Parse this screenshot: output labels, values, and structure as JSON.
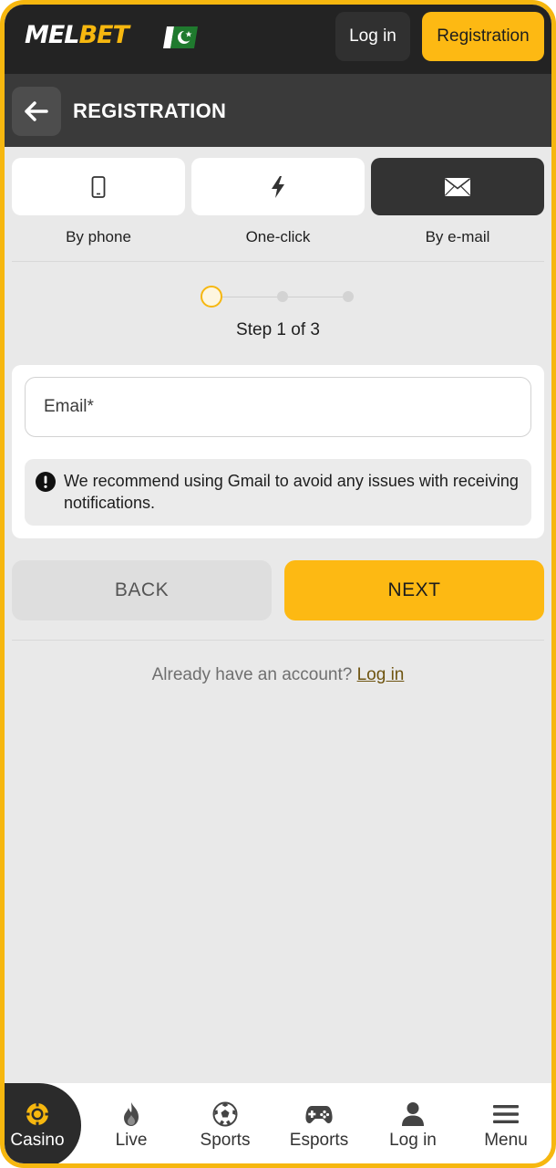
{
  "header": {
    "logo_part1": "MEL",
    "logo_part2": "BET",
    "login_label": "Log in",
    "registration_label": "Registration"
  },
  "titlebar": {
    "title": "REGISTRATION"
  },
  "tabs": [
    {
      "label": "By phone",
      "icon": "phone-icon",
      "active": false
    },
    {
      "label": "One-click",
      "icon": "lightning-icon",
      "active": false
    },
    {
      "label": "By e-mail",
      "icon": "envelope-icon",
      "active": true
    }
  ],
  "stepper": {
    "text": "Step 1 of 3",
    "current": 1,
    "total": 3
  },
  "form": {
    "email_placeholder": "Email*",
    "notice": "We recommend using Gmail to avoid any issues with receiving notifications."
  },
  "actions": {
    "back_label": "BACK",
    "next_label": "NEXT"
  },
  "footer": {
    "already_text": "Already have an account?",
    "login_link": "Log in"
  },
  "bottom_nav": [
    {
      "label": "Casino",
      "icon": "casino-chip-icon",
      "active": true
    },
    {
      "label": "Live",
      "icon": "flame-icon",
      "active": false
    },
    {
      "label": "Sports",
      "icon": "soccer-ball-icon",
      "active": false
    },
    {
      "label": "Esports",
      "icon": "gamepad-icon",
      "active": false
    },
    {
      "label": "Log in",
      "icon": "user-icon",
      "active": false
    },
    {
      "label": "Menu",
      "icon": "hamburger-menu-icon",
      "active": false
    }
  ],
  "colors": {
    "accent": "#fdb913",
    "header_bg": "#232323",
    "titlebar_bg": "#3a3a3a",
    "page_bg": "#e9e9e9"
  }
}
